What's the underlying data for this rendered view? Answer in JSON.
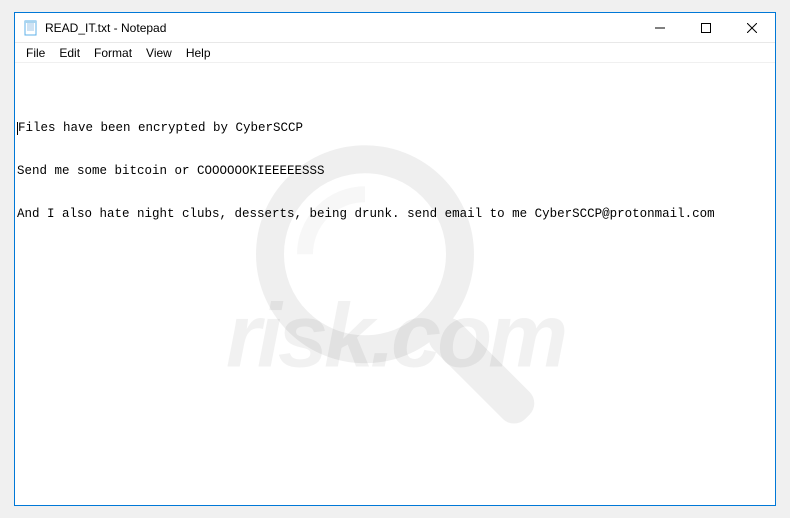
{
  "titlebar": {
    "title": "READ_IT.txt - Notepad",
    "icon_name": "notepad-icon"
  },
  "menubar": {
    "items": [
      "File",
      "Edit",
      "Format",
      "View",
      "Help"
    ]
  },
  "content": {
    "lines": [
      "Files have been encrypted by CyberSCCP",
      "Send me some bitcoin or COOOOOOKIEEEEESSS",
      "And I also hate night clubs, desserts, being drunk. send email to me CyberSCCP@protonmail.com"
    ]
  },
  "watermark": {
    "text": "risk.com"
  }
}
